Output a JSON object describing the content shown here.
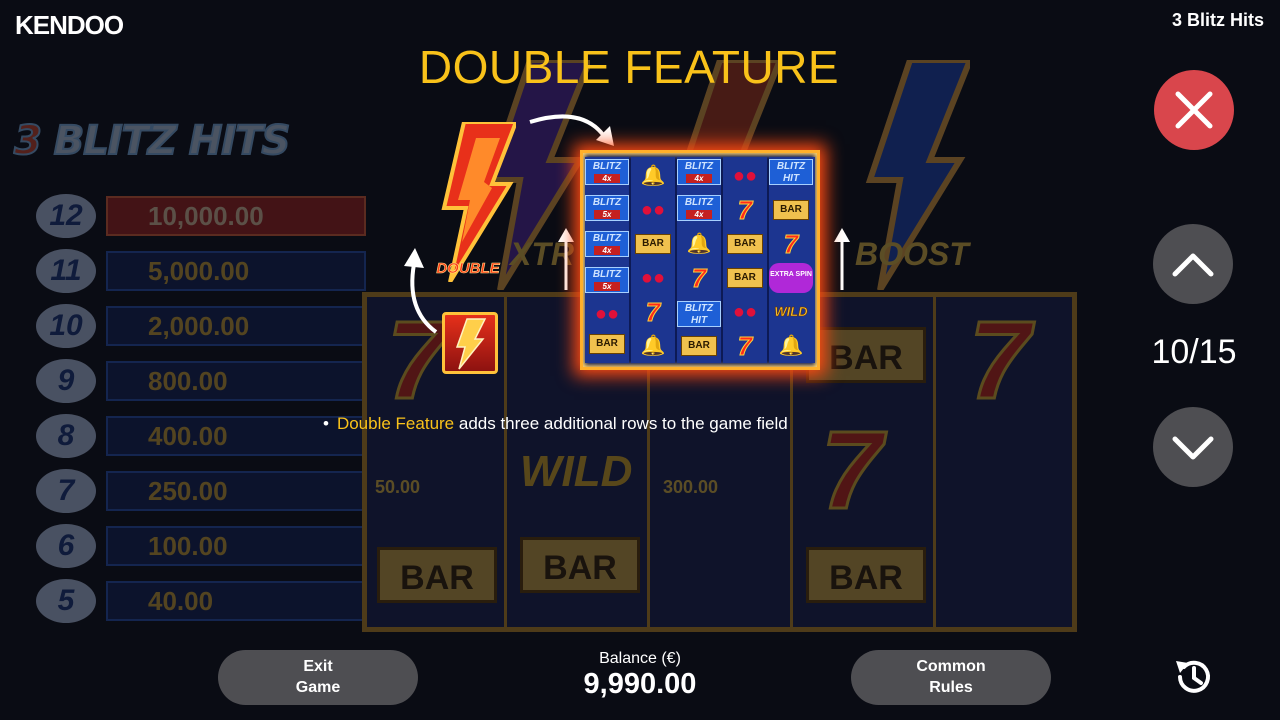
{
  "header": {
    "brand": "KENDOO",
    "game_title": "3 Blitz Hits"
  },
  "help_page": {
    "title": "DOUBLE FEATURE",
    "counter": "10/15",
    "bullet_highlight": "Double Feature",
    "bullet_text": " adds three additional rows to the game field",
    "double_label": "DOUBLE"
  },
  "background_game": {
    "logo_part1": "3",
    "logo_part2": "BLITZ HITS",
    "paytable": [
      {
        "count": "12",
        "value": "10,000.00"
      },
      {
        "count": "11",
        "value": "5,000.00"
      },
      {
        "count": "10",
        "value": "2,000.00"
      },
      {
        "count": "9",
        "value": "800.00"
      },
      {
        "count": "8",
        "value": "400.00"
      },
      {
        "count": "7",
        "value": "250.00"
      },
      {
        "count": "6",
        "value": "100.00"
      },
      {
        "count": "5",
        "value": "40.00"
      }
    ],
    "booster_1": "XTR",
    "booster_2": "BOOST",
    "blitz_value_1": "50.00",
    "blitz_value_2": "300.00"
  },
  "illustration": {
    "blitz": "BLITZ",
    "hit": "BLITZ HIT",
    "bar": "BAR",
    "wild": "WILD",
    "seven": "7",
    "extra_spin": "EXTRA SPIN",
    "mult_4x": "4x",
    "mult_5x": "5x"
  },
  "footer": {
    "exit_line1": "Exit",
    "exit_line2": "Game",
    "balance_label": "Balance (€)",
    "balance_value": "9,990.00",
    "rules_line1": "Common",
    "rules_line2": "Rules"
  },
  "colors": {
    "accent_yellow": "#f9c21a",
    "close_red": "#d9464c",
    "button_gray": "#4e4e52"
  },
  "icons": {
    "close": "close-icon",
    "up": "chevron-up-icon",
    "down": "chevron-down-icon",
    "history": "history-clock-icon"
  }
}
